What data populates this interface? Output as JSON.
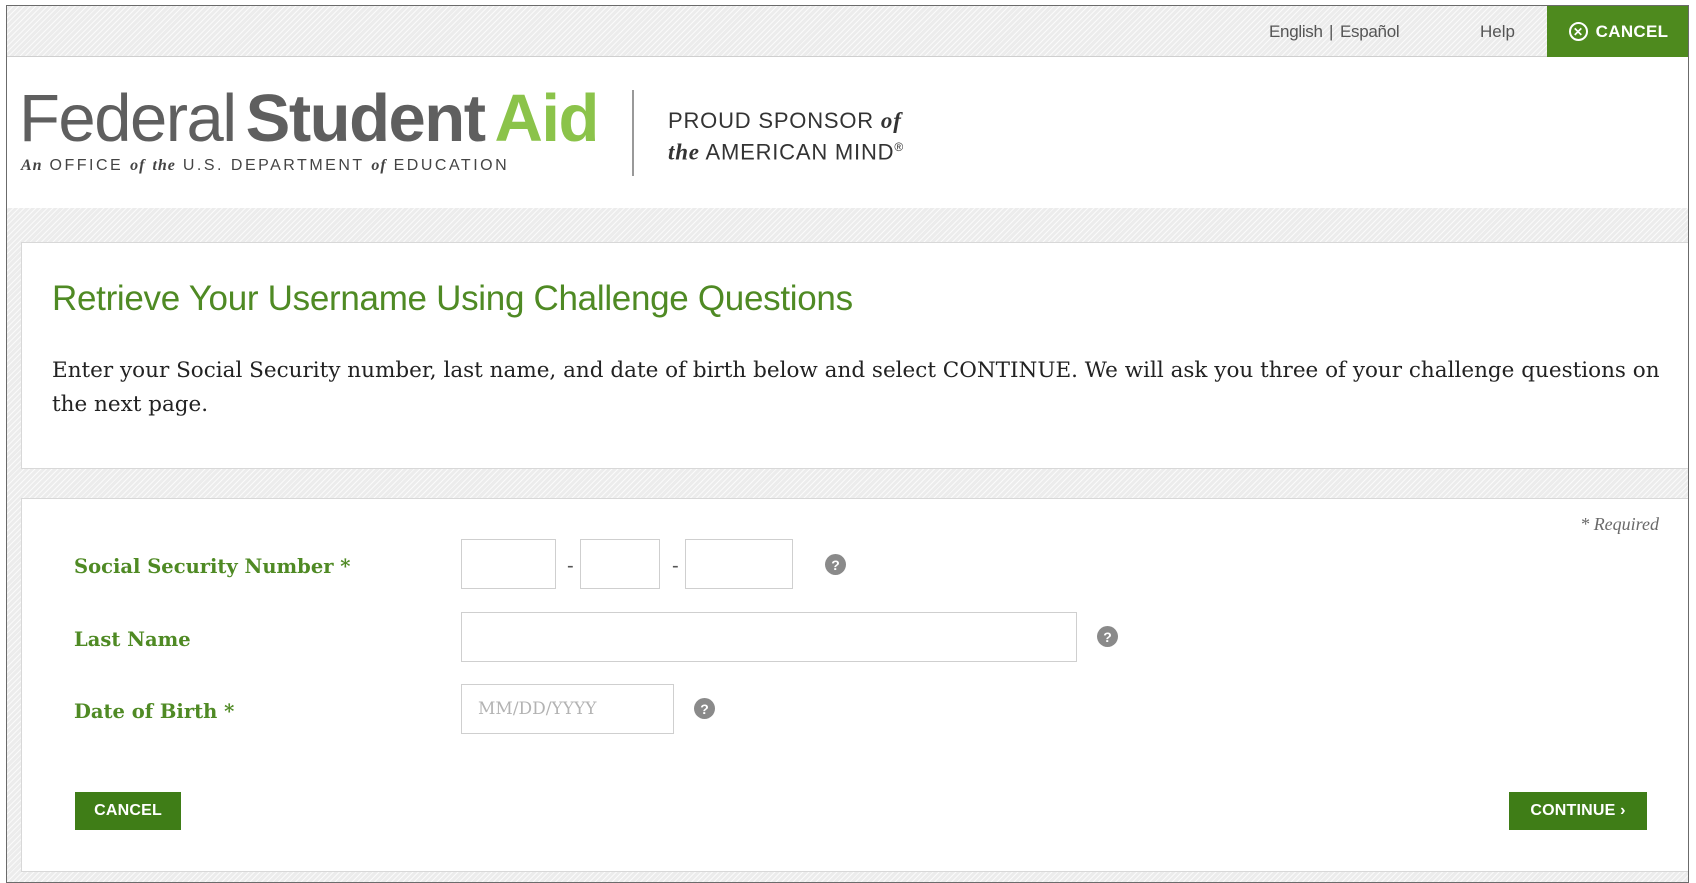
{
  "utility_bar": {
    "lang_english": "English",
    "lang_separator": "|",
    "lang_spanish": "Español",
    "help": "Help",
    "cancel": "CANCEL",
    "cancel_icon": "close-circle-icon"
  },
  "logo": {
    "word_federal": "Federal",
    "word_student": "Student",
    "word_aid": "Aid",
    "sub_an": "An",
    "sub_office": "OFFICE",
    "sub_of": "of",
    "sub_the": "the",
    "sub_us_dept": "U.S. DEPARTMENT",
    "sub_of2": "of",
    "sub_education": "EDUCATION",
    "sponsor_line1_a": "PROUD SPONSOR",
    "sponsor_line1_b": "of",
    "sponsor_line2_a": "the",
    "sponsor_line2_b": "AMERICAN MIND",
    "sponsor_reg": "®"
  },
  "intro": {
    "title": "Retrieve Your Username Using Challenge Questions",
    "description": "Enter your Social Security number, last name, and date of birth below and select CONTINUE. We will ask you three of your challenge questions on the next page."
  },
  "form": {
    "required_note": "* Required",
    "ssn_label": "Social Security Number *",
    "ssn_part1": "",
    "ssn_part2": "",
    "ssn_part3": "",
    "ssn_dash": "-",
    "last_name_label": "Last Name",
    "last_name_value": "",
    "dob_label": "Date of Birth *",
    "dob_value": "",
    "dob_placeholder": "MM/DD/YYYY",
    "help_glyph": "?",
    "cancel_button": "CANCEL",
    "continue_button": "CONTINUE ›"
  },
  "colors": {
    "brand_green": "#4f8a24",
    "button_green": "#3f7d17",
    "aid_green": "#8bc34a"
  }
}
